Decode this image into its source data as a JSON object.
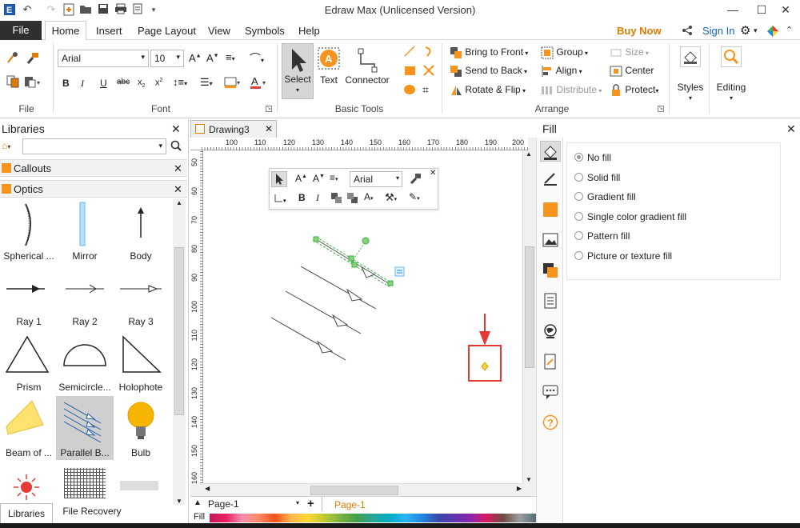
{
  "app": {
    "title": "Edraw Max (Unlicensed Version)",
    "window_controls": {
      "minimize": "—",
      "maximize": "☐",
      "close": "✕"
    }
  },
  "menubar": {
    "file": "File",
    "tabs": [
      "Home",
      "Insert",
      "Page Layout",
      "View",
      "Symbols",
      "Help"
    ],
    "buy_now": "Buy Now",
    "sign_in": "Sign In",
    "accent": "#e07b00"
  },
  "ribbon": {
    "groups": {
      "file": "File",
      "font": "Font",
      "basic_tools": "Basic Tools",
      "arrange": "Arrange"
    },
    "font_name": "Arial",
    "font_size": "10",
    "basic_tools": {
      "select": "Select",
      "text": "Text",
      "connector": "Connector"
    },
    "arrange": {
      "bring_to_front": "Bring to Front",
      "send_to_back": "Send to Back",
      "rotate_flip": "Rotate & Flip",
      "group": "Group",
      "align": "Align",
      "distribute": "Distribute",
      "size": "Size",
      "center": "Center",
      "protect": "Protect"
    },
    "styles": "Styles",
    "editing": "Editing"
  },
  "libraries": {
    "title": "Libraries",
    "categories": [
      "Callouts",
      "Optics"
    ],
    "shapes": [
      {
        "label": "Spherical ..."
      },
      {
        "label": "Mirror"
      },
      {
        "label": "Body"
      },
      {
        "label": "Ray 1"
      },
      {
        "label": "Ray 2"
      },
      {
        "label": "Ray 3"
      },
      {
        "label": "Prism"
      },
      {
        "label": "Semicircle..."
      },
      {
        "label": "Holophote"
      },
      {
        "label": "Beam of ..."
      },
      {
        "label": "Parallel B..."
      },
      {
        "label": "Bulb"
      }
    ],
    "bottom_tabs": [
      "Libraries",
      "File Recovery"
    ]
  },
  "document": {
    "tab": "Drawing3",
    "ruler_top": [
      "100",
      "110",
      "120",
      "130",
      "140",
      "150",
      "160",
      "170",
      "180",
      "190",
      "200"
    ],
    "ruler_left": [
      "50",
      "60",
      "70",
      "80",
      "90",
      "100",
      "110",
      "120",
      "130",
      "140",
      "150",
      "160"
    ],
    "floatbar_font": "Arial"
  },
  "pagebar": {
    "page_select": "Page-1",
    "page_tab": "Page-1",
    "fill_label": "Fill"
  },
  "fill_panel": {
    "title": "Fill",
    "options": [
      "No fill",
      "Solid fill",
      "Gradient fill",
      "Single color gradient fill",
      "Pattern fill",
      "Picture or texture fill"
    ],
    "selected": "No fill"
  },
  "colors": {
    "highlight_red": "#e53935",
    "orange": "#f7941d",
    "selection_green": "#3cb043"
  }
}
